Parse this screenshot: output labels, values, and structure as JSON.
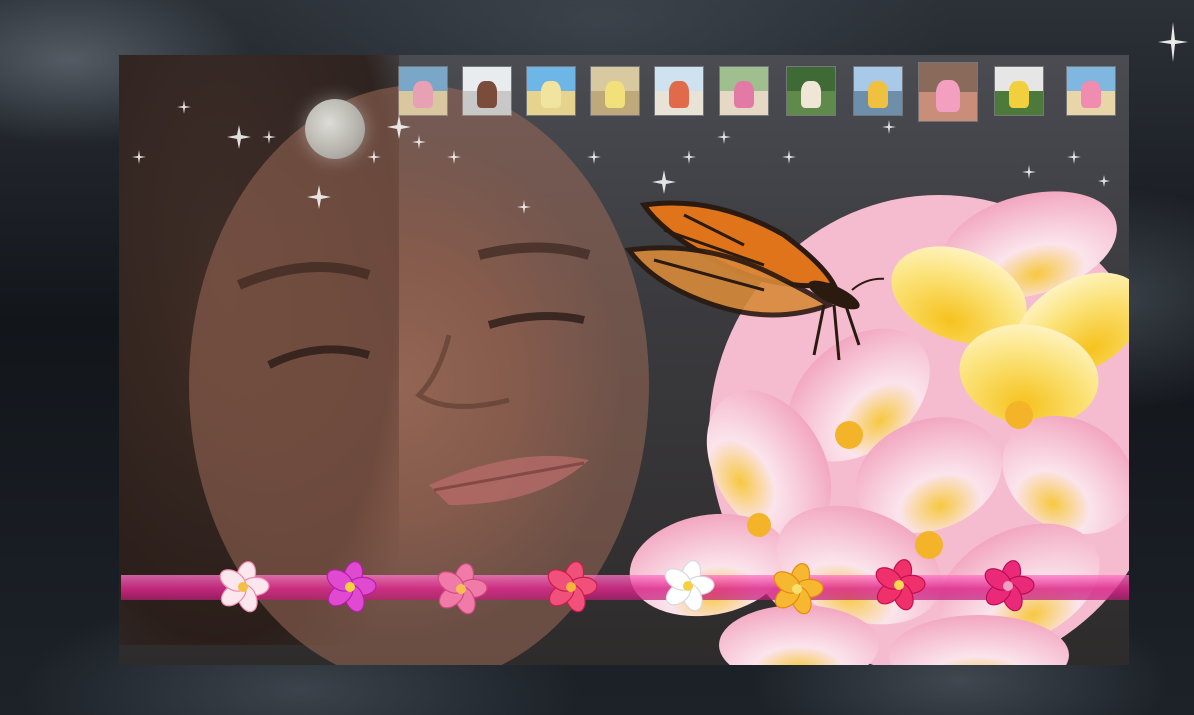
{
  "thumbnails": [
    {
      "id": "beach-bouquet-thumb",
      "sky": "#7aa6c8",
      "ground": "#d9c7a0",
      "subject": "#e8a0b5"
    },
    {
      "id": "couple-embrace-thumb",
      "sky": "#e9ecef",
      "ground": "#c8c8c8",
      "subject": "#7b4c3a"
    },
    {
      "id": "beach-altar-thumb",
      "sky": "#6fb6e8",
      "ground": "#e6d48e",
      "subject": "#f0e4a0"
    },
    {
      "id": "yellow-bouquet-thumb",
      "sky": "#d8c9a0",
      "ground": "#bfa97a",
      "subject": "#f2e07a"
    },
    {
      "id": "parasol-bride-thumb",
      "sky": "#cfe2f0",
      "ground": "#e9e2d6",
      "subject": "#e06a4a"
    },
    {
      "id": "bride-portrait-thumb",
      "sky": "#9fbf8e",
      "ground": "#e5d9c5",
      "subject": "#e37aa6"
    },
    {
      "id": "garden-couple-thumb",
      "sky": "#3f6a35",
      "ground": "#5f8a4b",
      "subject": "#efe6d5"
    },
    {
      "id": "couple-kiss-thumb",
      "sky": "#a9c9e8",
      "ground": "#6e8faa",
      "subject": "#f0c040"
    },
    {
      "id": "bride-closeup-thumb",
      "sky": "#8a6a5a",
      "ground": "#c98e7a",
      "subject": "#f3a0c0",
      "active": true
    },
    {
      "id": "lei-kiss-thumb",
      "sky": "#e6e6e6",
      "ground": "#4d7a3a",
      "subject": "#f2cf3c"
    },
    {
      "id": "beach-flowers-thumb",
      "sky": "#7fb7e0",
      "ground": "#e8d6a8",
      "subject": "#f08cb0"
    }
  ],
  "nav_flowers": [
    {
      "id": "white-pink-plumeria",
      "petal": "#fde7ef",
      "edge": "#f08aa8",
      "center": "#f5c040"
    },
    {
      "id": "magenta-plumeria",
      "petal": "#e04ad0",
      "edge": "#b51ea8",
      "center": "#f7d040"
    },
    {
      "id": "pink-plumeria",
      "petal": "#f07aa8",
      "edge": "#d24a80",
      "center": "#f6c050"
    },
    {
      "id": "red-pink-plumeria",
      "petal": "#f0507a",
      "edge": "#c81e4a",
      "center": "#f7b43a"
    },
    {
      "id": "white-plumeria",
      "petal": "#ffffff",
      "edge": "#d8d8e0",
      "center": "#f5d040"
    },
    {
      "id": "yellow-plumeria",
      "petal": "#f6b830",
      "edge": "#e68a10",
      "center": "#f5e070"
    },
    {
      "id": "hot-pink-plumeria",
      "petal": "#f0306a",
      "edge": "#c01050",
      "center": "#f8d850"
    },
    {
      "id": "fuchsia-plumeria",
      "petal": "#ea2a78",
      "edge": "#b80e54",
      "center": "#f2a0c0"
    }
  ],
  "colors": {
    "band": "#e0409a",
    "moon": "#cfcdc6",
    "butterfly_orange": "#e0741a",
    "butterfly_dark": "#2a1a10"
  }
}
